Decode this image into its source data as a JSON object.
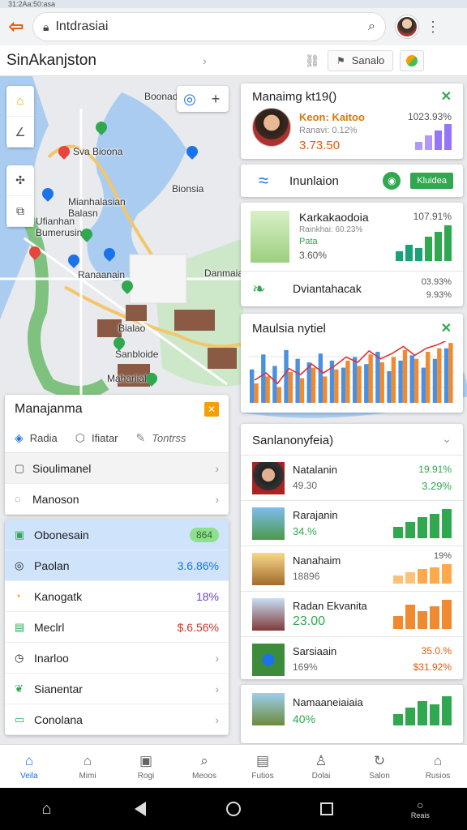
{
  "status": {
    "text": "31:2Aa:50:asa"
  },
  "browser": {
    "url": "Intdrasiai"
  },
  "header": {
    "title": "SinAkanjston",
    "button_label": "Sanalo"
  },
  "map": {
    "labels": [
      "Boonadi",
      "Sva Bioona",
      "Bionsia",
      "Mianhalasian Balasn",
      "Ufianhan Bumerusin",
      "Ranaanain",
      "Danmaianar",
      "Bialao",
      "Sanbloide",
      "Mahariialis"
    ]
  },
  "left_panel": {
    "title": "Manajanma",
    "tabs": [
      "Radia",
      "Ifiatar",
      "Tontrss"
    ],
    "rows": [
      "Sioulimanel",
      "Manoson"
    ]
  },
  "left_panel2": {
    "rows": [
      {
        "label": "Obonesain",
        "value": "864"
      },
      {
        "label": "Paolan",
        "value": "3.6.86%"
      },
      {
        "label": "Kanogatk",
        "value": "18%"
      },
      {
        "label": "Meclrl",
        "value": "$.6.56%"
      },
      {
        "label": "Inarloo",
        "value": ""
      },
      {
        "label": "Sianentar",
        "value": ""
      },
      {
        "label": "Conolana",
        "value": ""
      }
    ]
  },
  "cards": {
    "card1": {
      "title": "Manaimg kt19()",
      "name": "Keon: Kaitoo",
      "sub": "Ranavi: 0.12%",
      "value": "3.73.50",
      "pct": "1023.93%"
    },
    "card2": {
      "label": "Inunlaion",
      "button": "Kluidea"
    },
    "card3": {
      "title": "Karkakaodoia",
      "pct": "107.91%",
      "line2": "Rainkhai: 60.23%",
      "line3": "Pata",
      "line4": "3.60%",
      "row2": "Dviantahacak",
      "row2_a": "03.93%",
      "row2_b": "9.93%"
    },
    "card4": {
      "title": "Maulsia nytiel"
    }
  },
  "list_card": {
    "title": "Sanlanonyfeia)",
    "items": [
      {
        "title": "Natalanin",
        "sub": "49.30",
        "v1": "19.91%",
        "v2": "3.29%"
      },
      {
        "title": "Rarajanin",
        "sub": "34.%",
        "v1": "",
        "v2": ""
      },
      {
        "title": "Nanahaim",
        "sub": "18896",
        "v1": "19%",
        "v2": ""
      },
      {
        "title": "Radan Ekvanita",
        "sub": "23.00",
        "v1": "",
        "v2": ""
      },
      {
        "title": "Sarsiaain",
        "sub": "169%",
        "v1": "35.0.%",
        "v2": "$31.92%"
      }
    ]
  },
  "card6": {
    "title": "Namaaneiaiaia",
    "value": "40%"
  },
  "bottom_nav": [
    "Veila",
    "Mimi",
    "Rogi",
    "Meoos",
    "Futios",
    "Dolai",
    "Salon",
    "Rusios"
  ],
  "system_nav": {
    "right_label": "Reais"
  },
  "chart_data": [
    {
      "type": "bar",
      "series": [
        {
          "values": [
            38,
            55,
            42,
            60,
            50,
            46,
            56,
            48,
            40,
            52,
            44,
            58,
            36,
            48,
            54,
            40,
            50,
            62
          ]
        },
        {
          "values": [
            22,
            30,
            18,
            35,
            28,
            40,
            30,
            38,
            48,
            42,
            55,
            46,
            52,
            60,
            50,
            58,
            62,
            68
          ]
        }
      ],
      "colors": [
        "#4a8fe0",
        "#f08a30",
        "#e03030"
      ]
    }
  ]
}
